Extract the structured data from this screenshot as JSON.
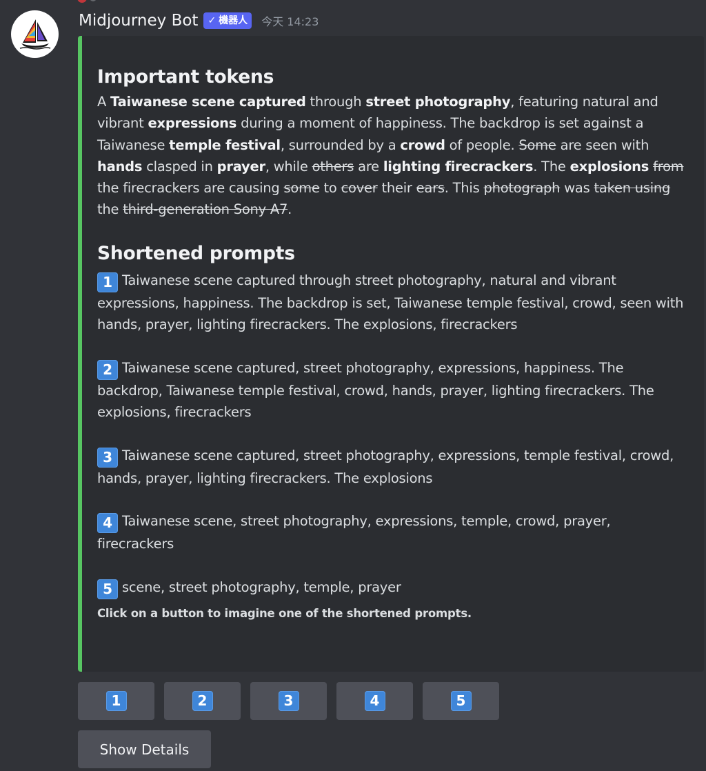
{
  "message": {
    "username": "Midjourney Bot",
    "badge_check": "✓",
    "badge_label": "機器人",
    "timestamp": "今天 14:23",
    "avatar_icon": "sailboat-icon"
  },
  "embed": {
    "accent_color": "#57c562",
    "important_title": "Important tokens",
    "important_text": [
      {
        "t": "A ",
        "s": "n"
      },
      {
        "t": "Taiwanese scene captured",
        "s": "b"
      },
      {
        "t": " through ",
        "s": "n"
      },
      {
        "t": "street photography",
        "s": "b"
      },
      {
        "t": ", featuring natural and vibrant ",
        "s": "n"
      },
      {
        "t": "expressions",
        "s": "b"
      },
      {
        "t": " during a moment of happiness. The backdrop is set against a Taiwanese ",
        "s": "n"
      },
      {
        "t": "temple festival",
        "s": "b"
      },
      {
        "t": ", surrounded by a ",
        "s": "n"
      },
      {
        "t": "crowd",
        "s": "b"
      },
      {
        "t": " of people. ",
        "s": "n"
      },
      {
        "t": "Some",
        "s": "x"
      },
      {
        "t": " are seen with ",
        "s": "n"
      },
      {
        "t": "hands",
        "s": "b"
      },
      {
        "t": " clasped in ",
        "s": "n"
      },
      {
        "t": "prayer",
        "s": "b"
      },
      {
        "t": ", while ",
        "s": "n"
      },
      {
        "t": "others",
        "s": "x"
      },
      {
        "t": " are ",
        "s": "n"
      },
      {
        "t": "lighting firecrackers",
        "s": "b"
      },
      {
        "t": ". The ",
        "s": "n"
      },
      {
        "t": "explosions",
        "s": "b"
      },
      {
        "t": " ",
        "s": "n"
      },
      {
        "t": "from",
        "s": "x"
      },
      {
        "t": " the firecrackers are causing ",
        "s": "n"
      },
      {
        "t": "some",
        "s": "x"
      },
      {
        "t": " to ",
        "s": "n"
      },
      {
        "t": "cover",
        "s": "x"
      },
      {
        "t": " their ",
        "s": "n"
      },
      {
        "t": "ears",
        "s": "x"
      },
      {
        "t": ". This ",
        "s": "n"
      },
      {
        "t": "photograph",
        "s": "x"
      },
      {
        "t": " was ",
        "s": "n"
      },
      {
        "t": "taken using",
        "s": "x"
      },
      {
        "t": " the ",
        "s": "n"
      },
      {
        "t": "third-generation Sony A7",
        "s": "x"
      },
      {
        "t": ".",
        "s": "n"
      }
    ],
    "shortened_title": "Shortened prompts",
    "prompts": [
      {
        "num": "1",
        "text": "Taiwanese scene captured through street photography, natural and vibrant expressions, happiness. The backdrop is set, Taiwanese temple festival, crowd, seen with hands, prayer, lighting firecrackers. The explosions, firecrackers"
      },
      {
        "num": "2",
        "text": "Taiwanese scene captured, street photography, expressions, happiness. The backdrop, Taiwanese temple festival, crowd, hands, prayer, lighting firecrackers. The explosions, firecrackers"
      },
      {
        "num": "3",
        "text": "Taiwanese scene captured, street photography, expressions, temple festival, crowd, hands, prayer, lighting firecrackers. The explosions"
      },
      {
        "num": "4",
        "text": "Taiwanese scene, street photography, expressions, temple, crowd, prayer, firecrackers"
      },
      {
        "num": "5",
        "text": "scene, street photography, temple, prayer"
      }
    ],
    "footer_note": "Click on a button to imagine one of the shortened prompts."
  },
  "buttons": {
    "numbers": [
      "1",
      "2",
      "3",
      "4",
      "5"
    ],
    "details_label": "Show Details"
  }
}
